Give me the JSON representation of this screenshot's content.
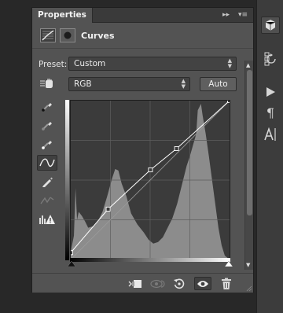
{
  "panel": {
    "tab_label": "Properties",
    "tab_ctrl_collapse": "▸▸",
    "tab_ctrl_menu": "▾≡",
    "title": "Curves"
  },
  "controls": {
    "preset_label": "Preset:",
    "preset_value": "Custom",
    "channel_value": "RGB",
    "auto_label": "Auto"
  },
  "curve": {
    "points_input_output": [
      [
        0,
        11
      ],
      [
        60,
        81
      ],
      [
        128,
        144
      ],
      [
        170,
        178
      ],
      [
        255,
        255
      ]
    ]
  },
  "icons": {
    "header": [
      "adjustment-curves-icon",
      "layer-mask-icon"
    ],
    "tools": [
      "on-image-adjust-icon",
      "sample-black-point-icon",
      "sample-gray-point-icon",
      "sample-white-point-icon",
      "point-edit-icon",
      "pencil-draw-icon",
      "smooth-curve-icon",
      "clipping-warning-icon"
    ],
    "footer": [
      "clip-to-layer-icon",
      "view-previous-state-icon",
      "reset-icon",
      "toggle-visibility-icon",
      "delete-icon"
    ],
    "right_strip": [
      "3d-cube-icon",
      "history-icon",
      "actions-play-icon",
      "paragraph-icon",
      "character-icon"
    ]
  },
  "colors": {
    "panel_bg": "#535353",
    "graph_bg": "#3b3b3b",
    "histogram": "#8c8c8c",
    "curve": "#ffffff"
  }
}
